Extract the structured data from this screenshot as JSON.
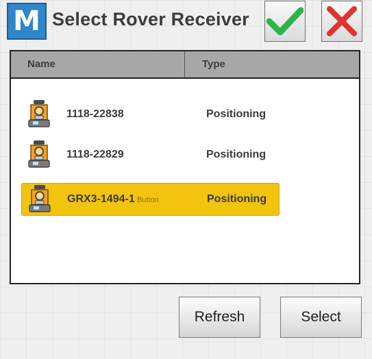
{
  "dialog": {
    "logo_letter": "M",
    "title": "Select Rover Receiver"
  },
  "list": {
    "columns": {
      "name": "Name",
      "type": "Type"
    },
    "rows": [
      {
        "name": "1118-22838",
        "type": "Positioning",
        "icon": "total-station-icon",
        "selected": false
      },
      {
        "name": "1118-22829",
        "type": "Positioning",
        "icon": "total-station-icon",
        "selected": false
      },
      {
        "name": "GRX3-1494-1",
        "type": "Positioning",
        "icon": "total-station-icon",
        "selected": true,
        "overlay_text": "Button"
      }
    ]
  },
  "footer": {
    "refresh_label": "Refresh",
    "select_label": "Select"
  },
  "colors": {
    "selection": "#f2c40f",
    "accept": "#2fb24a",
    "cancel": "#e0332d",
    "logo": "#2f86c8"
  }
}
